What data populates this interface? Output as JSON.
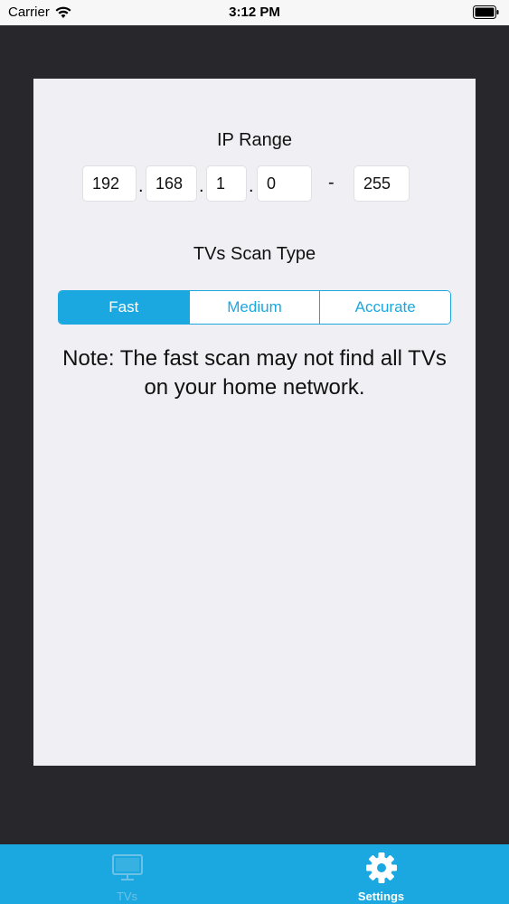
{
  "status_bar": {
    "carrier": "Carrier",
    "time": "3:12 PM"
  },
  "ip_range": {
    "title": "IP Range",
    "octets": [
      "192",
      "168",
      "1",
      "0"
    ],
    "end": "255",
    "separator": ".",
    "dash": "-"
  },
  "scan_type": {
    "title": "TVs Scan Type",
    "options": [
      "Fast",
      "Medium",
      "Accurate"
    ],
    "selected": "Fast"
  },
  "note": "Note: The fast scan may not find all TVs on your home network.",
  "tab_bar": {
    "tabs": [
      {
        "label": "TVs",
        "icon": "tv-icon",
        "active": false
      },
      {
        "label": "Settings",
        "icon": "gear-icon",
        "active": true
      }
    ]
  },
  "colors": {
    "accent": "#1ba8e0",
    "background": "#28272c",
    "card": "#efeff4"
  }
}
